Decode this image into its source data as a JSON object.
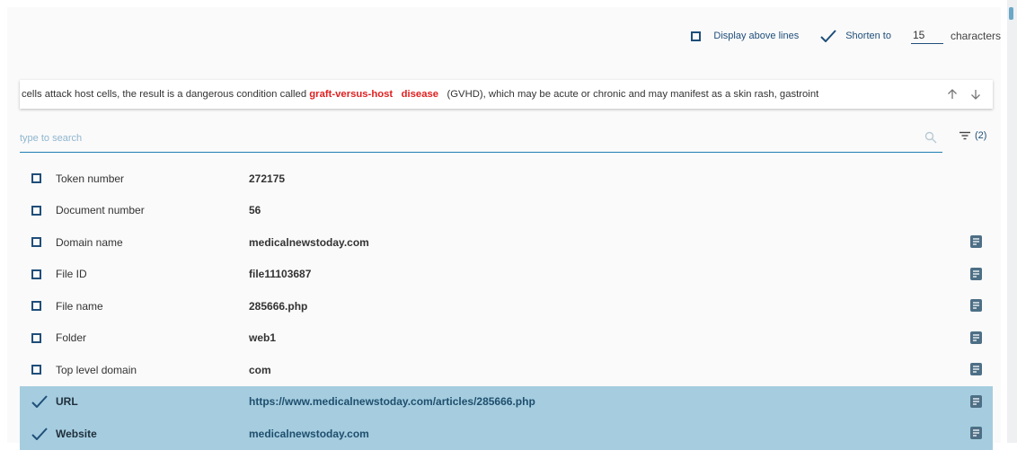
{
  "options": {
    "display_above_lines_label": "Display above lines",
    "shorten_to_label": "Shorten to",
    "shorten_value": "15",
    "characters_label": "characters"
  },
  "excerpt": {
    "before": "cells attack host cells, the result is a dangerous condition called ",
    "highlight1": "graft-versus-host",
    "highlight2": "disease",
    "after": " (GVHD), which may be acute or chronic and may manifest as a skin rash, gastroint",
    "highlight_color": "#e02020"
  },
  "search": {
    "placeholder": "type to search",
    "filter_count": "(2)"
  },
  "rows": [
    {
      "name": "Token number",
      "value": "272175",
      "checked": false,
      "doc": false
    },
    {
      "name": "Document number",
      "value": "56",
      "checked": false,
      "doc": false
    },
    {
      "name": "Domain name",
      "value": "medicalnewstoday.com",
      "checked": false,
      "doc": true
    },
    {
      "name": "File ID",
      "value": "file11103687",
      "checked": false,
      "doc": true
    },
    {
      "name": "File name",
      "value": "285666.php",
      "checked": false,
      "doc": true
    },
    {
      "name": "Folder",
      "value": "web1",
      "checked": false,
      "doc": true
    },
    {
      "name": "Top level domain",
      "value": "com",
      "checked": false,
      "doc": true
    },
    {
      "name": "URL",
      "value": "https://www.medicalnewstoday.com/articles/285666.php",
      "checked": true,
      "doc": true
    },
    {
      "name": "Website",
      "value": "medicalnewstoday.com",
      "checked": true,
      "doc": true
    }
  ],
  "colors": {
    "accent": "#1f4e79",
    "selected_row": "#a5cddf",
    "doc_icon": "#4d6f86"
  }
}
